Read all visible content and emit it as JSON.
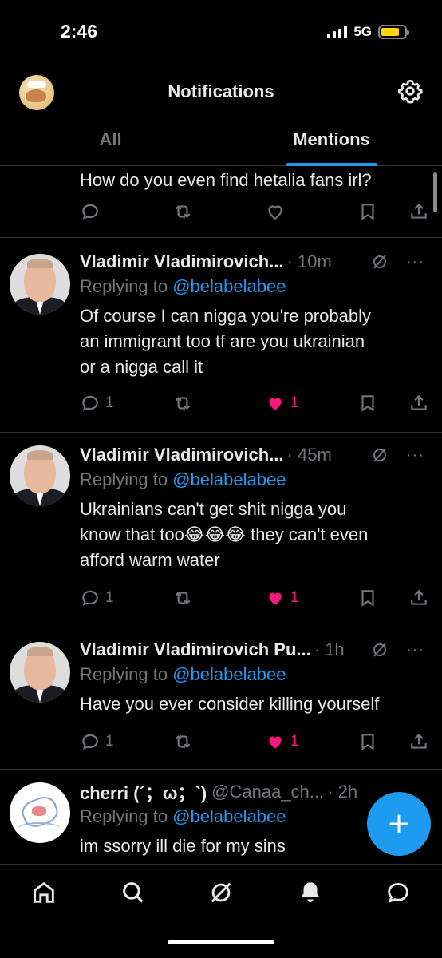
{
  "status_bar": {
    "time": "2:46",
    "network": "5G"
  },
  "header": {
    "title": "Notifications"
  },
  "tabs": [
    {
      "label": "All",
      "active": false
    },
    {
      "label": "Mentions",
      "active": true
    }
  ],
  "partial_tweet": {
    "text": "How do you even find hetalia fans irl?"
  },
  "tweets": [
    {
      "author": "Vladimir Vladimirovich...",
      "time": "· 10m",
      "replying_label": "Replying to",
      "reply_handle": "@belabelabee",
      "text_lines": [
        "Of course I can nigga you're probably",
        "an  immigrant too tf are you ukrainian",
        "or a nigga call it"
      ],
      "replies": "1",
      "likes": "1",
      "liked": true
    },
    {
      "author": "Vladimir Vladimirovich...",
      "time": "· 45m",
      "replying_label": "Replying to",
      "reply_handle": "@belabelabee",
      "text_lines": [
        "Ukrainians can't get shit nigga you",
        "know that too😂😂😂 they can't even",
        "afford warm water"
      ],
      "replies": "1",
      "likes": "1",
      "liked": true
    },
    {
      "author": "Vladimir Vladimirovich Pu...",
      "time": "· 1h",
      "replying_label": "Replying to",
      "reply_handle": "@belabelabee",
      "text_lines": [
        "Have you ever consider killing yourself"
      ],
      "replies": "1",
      "likes": "1",
      "liked": true
    },
    {
      "author": "cherri (´；ω；`)",
      "handle": "@Canaa_ch...",
      "time": "· 2h",
      "replying_label": "Replying to",
      "reply_handle": "@belabelabee",
      "text_lines": [
        "im ssorry ill die for my sins"
      ]
    }
  ],
  "icons": {
    "settings": "gear-icon",
    "reply": "speech-bubble-icon",
    "retweet": "retweet-icon",
    "like": "heart-icon",
    "bookmark": "bookmark-icon",
    "share": "share-icon",
    "grok": "grok-icon",
    "more": "more-icon",
    "compose": "plus-icon",
    "nav": [
      "home-icon",
      "search-icon",
      "grok-icon",
      "bell-icon",
      "messages-icon"
    ]
  },
  "colors": {
    "accent": "#1d9bf0",
    "like": "#f91880",
    "muted": "#71767b",
    "text": "#e7e9ea",
    "background": "#000000",
    "battery": "#ffd60a"
  }
}
